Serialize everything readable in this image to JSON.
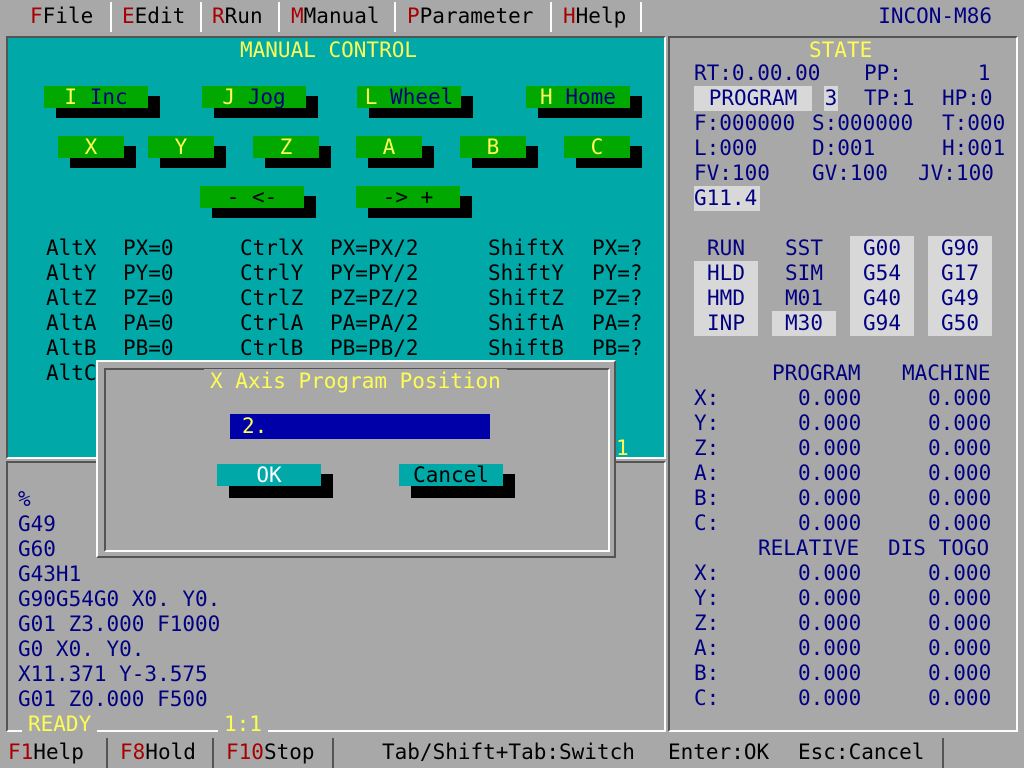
{
  "app_title": "INCON-M86",
  "menu": [
    {
      "key": "F",
      "label": "File"
    },
    {
      "key": "E",
      "label": "Edit"
    },
    {
      "key": "R",
      "label": "Run"
    },
    {
      "key": "M",
      "label": "Manual"
    },
    {
      "key": "P",
      "label": "Parameter"
    },
    {
      "key": "H",
      "label": "Help"
    }
  ],
  "manual": {
    "title": "MANUAL CONTROL",
    "mode_buttons": [
      {
        "key": "I",
        "label": "Inc"
      },
      {
        "key": "J",
        "label": "Jog"
      },
      {
        "key": "L",
        "label": "Wheel"
      },
      {
        "key": "H",
        "label": "Home"
      }
    ],
    "axis_buttons": [
      "X",
      "Y",
      "Z",
      "A",
      "B",
      "C"
    ],
    "dir_minus": "- <-",
    "dir_plus": "-> +",
    "shortcuts": [
      [
        "AltX",
        "PX=0",
        "CtrlX",
        "PX=PX/2",
        "ShiftX",
        "PX=?"
      ],
      [
        "AltY",
        "PY=0",
        "CtrlY",
        "PY=PY/2",
        "ShiftY",
        "PY=?"
      ],
      [
        "AltZ",
        "PZ=0",
        "CtrlZ",
        "PZ=PZ/2",
        "ShiftZ",
        "PZ=?"
      ],
      [
        "AltA",
        "PA=0",
        "CtrlA",
        "PA=PA/2",
        "ShiftA",
        "PA=?"
      ],
      [
        "AltB",
        "PB=0",
        "CtrlB",
        "PB=PB/2",
        "ShiftB",
        "PB=?"
      ],
      [
        "AltC",
        "",
        "",
        "",
        "",
        "=?"
      ]
    ],
    "corner_value": "1"
  },
  "state": {
    "title": "STATE",
    "rt": "RT:0.00.00",
    "pp": "PP:      1",
    "program_label": "PROGRAM",
    "program_num": "3",
    "tp": "TP:1",
    "hp": "HP:0",
    "f": "F:000000",
    "s": "S:000000",
    "t": "T:000",
    "l": "L:000",
    "d": "D:001",
    "h": "H:001",
    "fv": "FV:100",
    "gv": "GV:100",
    "jv": "JV:100",
    "gcode": "G11.4",
    "modes": [
      [
        "RUN",
        "SST",
        "G00",
        "G90"
      ],
      [
        "HLD",
        "SIM",
        "G54",
        "G17"
      ],
      [
        "HMD",
        "M01",
        "G40",
        "G49"
      ],
      [
        "INP",
        "M30",
        "G94",
        "G50"
      ]
    ],
    "pos_headers": [
      "PROGRAM",
      "MACHINE"
    ],
    "pos_headers2": [
      "RELATIVE",
      "DIS TOGO"
    ],
    "positions": [
      {
        "axis": "X:",
        "a": "0.000",
        "b": "0.000"
      },
      {
        "axis": "Y:",
        "a": "0.000",
        "b": "0.000"
      },
      {
        "axis": "Z:",
        "a": "0.000",
        "b": "0.000"
      },
      {
        "axis": "A:",
        "a": "0.000",
        "b": "0.000"
      },
      {
        "axis": "B:",
        "a": "0.000",
        "b": "0.000"
      },
      {
        "axis": "C:",
        "a": "0.000",
        "b": "0.000"
      }
    ],
    "relatives": [
      {
        "axis": "X:",
        "a": "0.000",
        "b": "0.000"
      },
      {
        "axis": "Y:",
        "a": "0.000",
        "b": "0.000"
      },
      {
        "axis": "Z:",
        "a": "0.000",
        "b": "0.000"
      },
      {
        "axis": "A:",
        "a": "0.000",
        "b": "0.000"
      },
      {
        "axis": "B:",
        "a": "0.000",
        "b": "0.000"
      },
      {
        "axis": "C:",
        "a": "0.000",
        "b": "0.000"
      }
    ]
  },
  "program": {
    "lines": [
      "%",
      "G49",
      "G60",
      "G43H1",
      "G90G54G0 X0. Y0.",
      "G01 Z3.000 F1000",
      "G0 X0. Y0.",
      "X11.371 Y-3.575",
      "G01 Z0.000 F500"
    ],
    "status": "READY",
    "position": "1:1"
  },
  "dialog": {
    "title": "X Axis Program Position",
    "value": "2.",
    "ok": "OK",
    "cancel": "Cancel"
  },
  "statusbar": {
    "items": [
      {
        "key": "F1",
        "label": "Help"
      },
      {
        "key": "F8",
        "label": "Hold"
      },
      {
        "key": "F10",
        "label": "Stop"
      }
    ],
    "hint_switch": "Tab/Shift+Tab:Switch",
    "hint_ok": "Enter:OK",
    "hint_cancel": "Esc:Cancel"
  }
}
